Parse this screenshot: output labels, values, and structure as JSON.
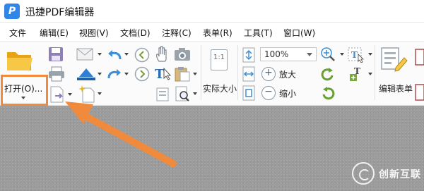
{
  "app": {
    "title": "迅捷PDF编辑器",
    "logo_letter": "P",
    "brand_color": "#2f86e6"
  },
  "menu": [
    {
      "label": "文件"
    },
    {
      "label": "编辑(E)"
    },
    {
      "label": "视图(V)"
    },
    {
      "label": "文档(D)"
    },
    {
      "label": "注释(C)"
    },
    {
      "label": "表单(R)"
    },
    {
      "label": "工具(T)"
    },
    {
      "label": "窗口(W)"
    }
  ],
  "toolbar": {
    "open_label": "打开(O)...",
    "actual_size_icon_text": "1:1",
    "actual_size_label": "实际大小",
    "zoom_value": "100%",
    "zoom_in_label": "放大",
    "zoom_out_label": "缩小",
    "edit_form_label": "编辑表单",
    "highlight_color": "#f08a3c"
  },
  "annotation": {
    "arrow_color": "#f08a3c"
  },
  "watermark": {
    "text": "创新互联"
  }
}
